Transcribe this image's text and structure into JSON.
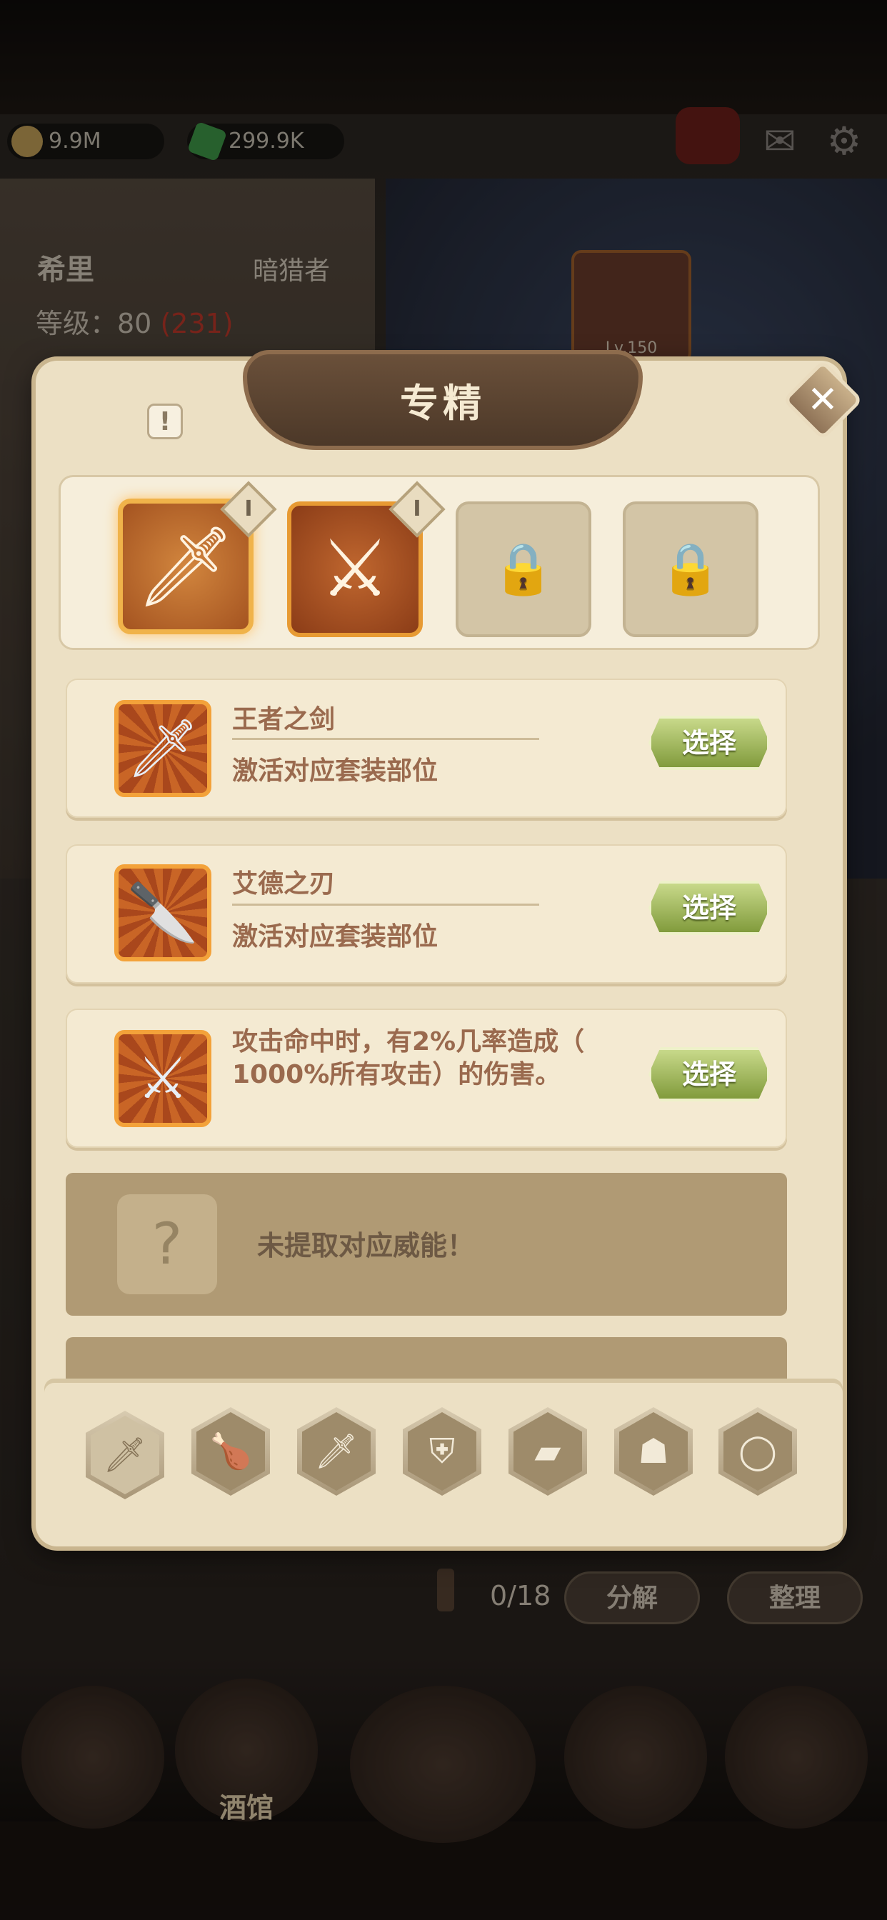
{
  "resources": {
    "gold": "9.9M",
    "gems": "299.9K"
  },
  "hero": {
    "name": "希里",
    "class": "暗猎者",
    "level_label": "等级：80",
    "level_bonus": "(231)"
  },
  "portrait_level": "Lv.150",
  "modal": {
    "title": "专精",
    "info": "!",
    "slots": [
      {
        "state": "active",
        "icon": "scimitar-icon"
      },
      {
        "state": "filled",
        "icon": "claw-icon"
      },
      {
        "state": "locked",
        "icon": "lock-icon"
      },
      {
        "state": "locked",
        "icon": "lock-icon"
      }
    ],
    "options": [
      {
        "title": "王者之剑",
        "desc": "激活对应套装部位",
        "button": "选择",
        "icon": "sword-icon"
      },
      {
        "title": "艾德之刃",
        "desc": "激活对应套装部位",
        "button": "选择",
        "icon": "dagger-icon"
      },
      {
        "text_line1": "攻击命中时，有2%几率造成（",
        "text_line2": "1000%所有攻击）的伤害。",
        "button": "选择",
        "icon": "spiral-blade-icon"
      }
    ],
    "empty_text": "未提取对应威能！",
    "empty_symbol": "?",
    "tabs": [
      "weapon",
      "drumstick",
      "sword",
      "shield",
      "book",
      "armor",
      "ring"
    ]
  },
  "inventory": {
    "count": "0/18",
    "decompose": "分解",
    "organize": "整理"
  },
  "nav": {
    "tavern": "酒馆"
  },
  "colors": {
    "accent": "#f3a23a",
    "select_green": "#819b3c",
    "parchment": "#ece0c4",
    "text_brown": "#9a6a4e"
  }
}
